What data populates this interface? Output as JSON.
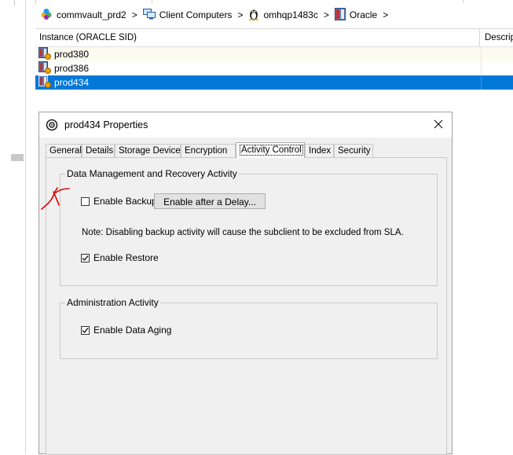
{
  "breadcrumb": {
    "items": [
      {
        "label": "commvault_prd2",
        "icon": "commcell-icon"
      },
      {
        "label": "Client Computers",
        "icon": "client-computers-icon"
      },
      {
        "label": "omhqp1483c",
        "icon": "linux-penguin-icon"
      },
      {
        "label": "Oracle",
        "icon": "oracle-agent-icon"
      }
    ],
    "separator": ">"
  },
  "table": {
    "columns": [
      "Instance (ORACLE SID)",
      "Descrip"
    ],
    "rows": [
      {
        "name": "prod380",
        "selected": false
      },
      {
        "name": "prod386",
        "selected": false
      },
      {
        "name": "prod434",
        "selected": true
      }
    ]
  },
  "dialog": {
    "title": "prod434 Properties",
    "tabs": [
      "General",
      "Details",
      "Storage Device",
      "Encryption",
      "Activity Control",
      "Index",
      "Security"
    ],
    "active_tab": "Activity Control",
    "groups": {
      "data_management": {
        "title": "Data Management and Recovery Activity",
        "enable_backup": {
          "label": "Enable Backup",
          "checked": false
        },
        "delay_button": "Enable after a Delay...",
        "note": "Note: Disabling backup activity will cause the subclient to be excluded from SLA.",
        "enable_restore": {
          "label": "Enable Restore",
          "checked": true
        }
      },
      "administration": {
        "title": "Administration Activity",
        "enable_data_aging": {
          "label": "Enable Data Aging",
          "checked": true
        }
      }
    }
  },
  "colors": {
    "selection": "#0078d7",
    "annotation": "#e00000"
  }
}
